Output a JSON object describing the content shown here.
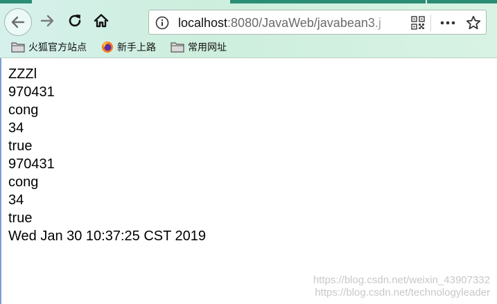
{
  "toolbar": {
    "url_host": "localhost",
    "url_rest": ":8080/JavaWeb/javabean3.j"
  },
  "bookmarks": [
    {
      "label": "火狐官方站点",
      "icon": "folder-icon"
    },
    {
      "label": "新手上路",
      "icon": "firefox-icon"
    },
    {
      "label": "常用网址",
      "icon": "folder-icon"
    }
  ],
  "page": {
    "lines": [
      "ZZZl",
      "970431",
      "cong",
      "34",
      "true",
      "970431",
      "cong",
      "34",
      "true",
      "Wed Jan 30 10:37:25 CST 2019"
    ]
  },
  "watermark": {
    "line1": "https://blog.csdn.net/weixin_43907332",
    "line2": "https://blog.csdn.net/technologyleader"
  },
  "colors": {
    "tab_accent": "#2a8d74",
    "chrome_bg": "#d6f1ec"
  }
}
